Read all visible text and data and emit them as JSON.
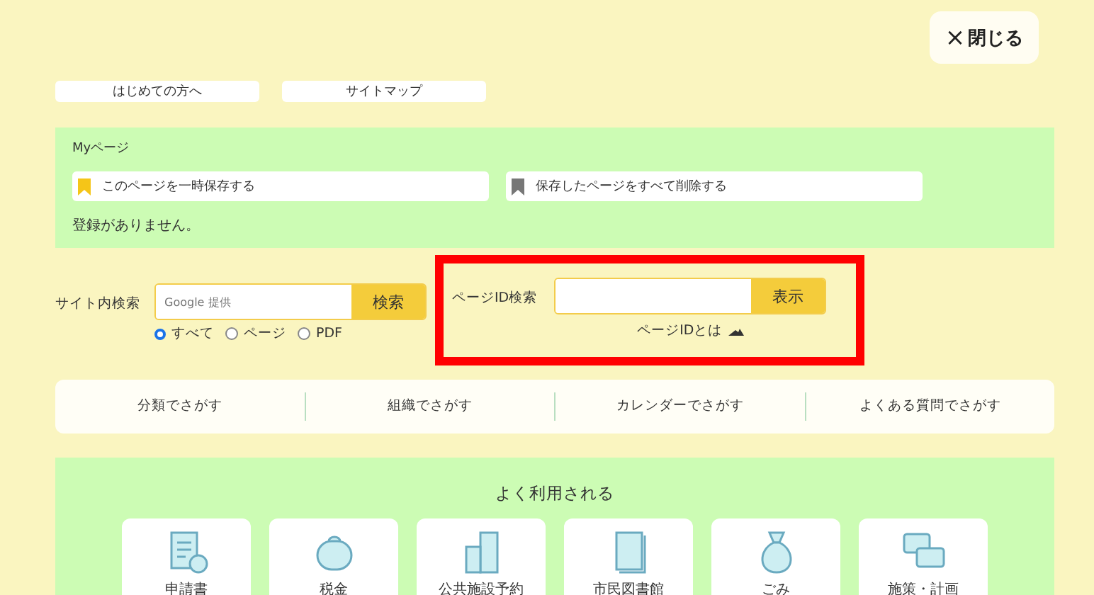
{
  "close_button": {
    "label": "閉じる",
    "icon": "×"
  },
  "top_links": [
    "はじめての方へ",
    "サイトマップ"
  ],
  "my_page": {
    "title": "Myページ",
    "actions": [
      {
        "label": "このページを一時保存する",
        "kind": "save"
      },
      {
        "label": "保存したページをすべて削除する",
        "kind": "delete"
      }
    ],
    "message": "登録がありません。"
  },
  "site_search": {
    "label": "サイト内検索",
    "placeholder": "Google 提供",
    "button": "検索",
    "scopes": [
      {
        "label": "すべて",
        "selected": true
      },
      {
        "label": "ページ",
        "selected": false
      },
      {
        "label": "PDF",
        "selected": false
      }
    ]
  },
  "page_id_search": {
    "label": "ページID検索",
    "button": "表示",
    "help_link": "ページIDとは"
  },
  "browse_tabs": [
    "分類でさがす",
    "組織でさがす",
    "カレンダーでさがす",
    "よくある質問でさがす"
  ],
  "popular": {
    "title": "よく利用される",
    "tiles": [
      {
        "label": "申請書"
      },
      {
        "label": "税金"
      },
      {
        "label": "公共施設予約"
      },
      {
        "label": "市民図書館"
      },
      {
        "label": "ごみ"
      },
      {
        "label": "施策・計画"
      }
    ]
  }
}
